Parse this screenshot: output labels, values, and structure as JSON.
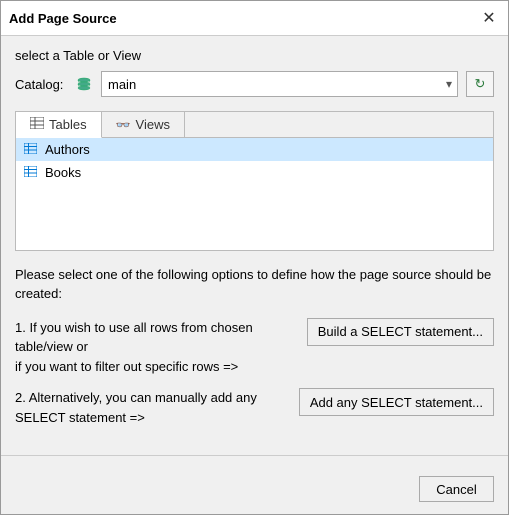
{
  "dialog": {
    "title": "Add Page Source",
    "close_label": "✕"
  },
  "catalog_section": {
    "select_label": "select a Table or View",
    "catalog_label": "Catalog:",
    "catalog_value": "main",
    "catalog_options": [
      "main"
    ],
    "refresh_icon": "↻"
  },
  "tabs": [
    {
      "id": "tables",
      "label": "Tables",
      "active": true
    },
    {
      "id": "views",
      "label": "Views",
      "active": false
    }
  ],
  "table_list": [
    {
      "name": "Authors"
    },
    {
      "name": "Books"
    }
  ],
  "instructions": "Please select one of the following options to define how the page source should be created:",
  "options": [
    {
      "number": "1.",
      "text": "If you wish to use all rows from chosen table/view or\nif you want to filter out specific rows =>",
      "button_label": "Build a SELECT statement..."
    },
    {
      "number": "2.",
      "text": "Alternatively, you can manually add any SELECT statement =>",
      "button_label": "Add any SELECT statement..."
    }
  ],
  "footer": {
    "cancel_label": "Cancel"
  }
}
